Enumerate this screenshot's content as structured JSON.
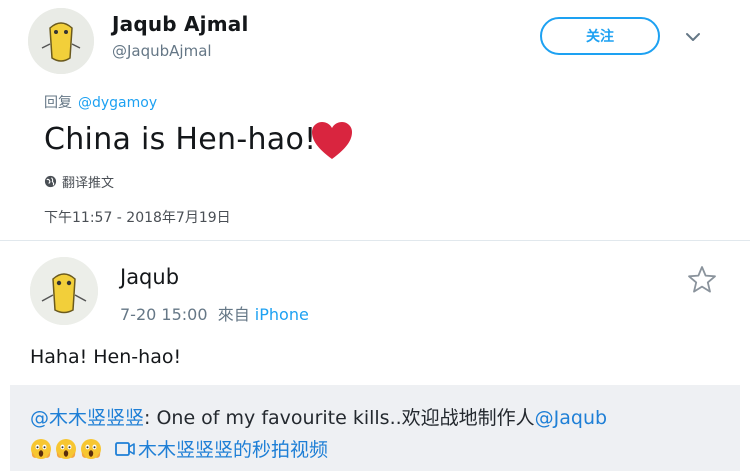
{
  "tweet": {
    "author_name": "Jaqub Ajmal",
    "author_handle": "@JaqubAjmal",
    "follow_label": "关注",
    "reply_prefix": "回复",
    "reply_to": "@dygamoy",
    "text": "China is Hen-hao!",
    "translate_label": "翻译推文",
    "timestamp": "下午11:57 - 2018年7月19日"
  },
  "reply": {
    "author": "Jaqub",
    "time": "7-20 15:00",
    "source_prefix": "來自",
    "source": "iPhone",
    "text": "Haha! Hen-hao!"
  },
  "quote": {
    "mention": "@木木竖竖竖",
    "body": ": One of my favourite kills..欢迎战地制作人",
    "mention_2": "@Jaqub",
    "video_link": "木木竖竖竖的秒拍视频"
  },
  "colors": {
    "accent": "#1da1f2",
    "heart": "#e0245e",
    "link_blue": "#1e7fd6",
    "quote_bg": "#eef0f3"
  },
  "icons": [
    "heart-emoji",
    "globe-icon",
    "chevron-down-icon",
    "star-icon",
    "screaming-face-emoji",
    "video-icon"
  ]
}
